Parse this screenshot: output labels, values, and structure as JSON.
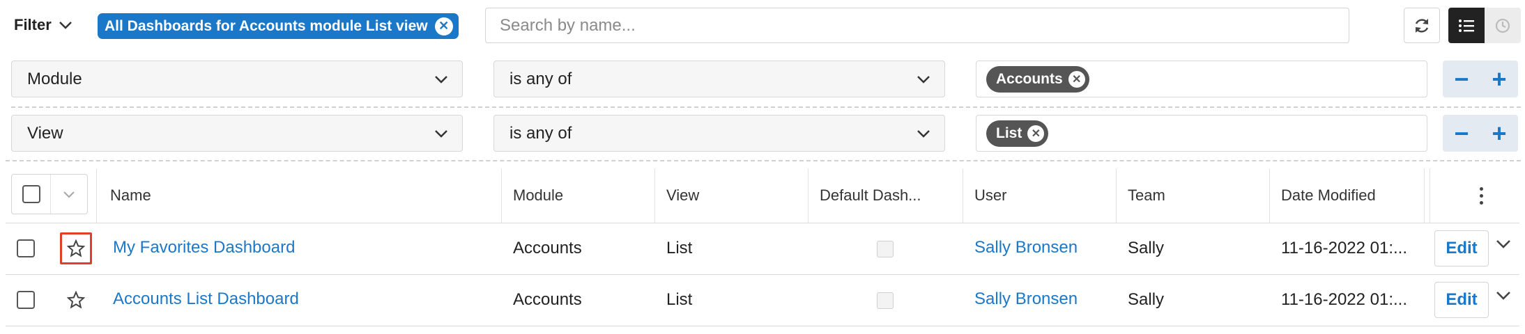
{
  "toolbar": {
    "filter_label": "Filter",
    "active_filter": "All Dashboards for Accounts module List view",
    "search_placeholder": "Search by name..."
  },
  "filter_rows": [
    {
      "field": "Module",
      "operator": "is any of",
      "tags": [
        "Accounts"
      ]
    },
    {
      "field": "View",
      "operator": "is any of",
      "tags": [
        "List"
      ]
    }
  ],
  "table": {
    "columns": [
      "Name",
      "Module",
      "View",
      "Default Dash...",
      "User",
      "Team",
      "Date Modified"
    ],
    "rows": [
      {
        "name": "My Favorites Dashboard",
        "module": "Accounts",
        "view": "List",
        "user": "Sally Bronsen",
        "team": "Sally",
        "date_modified": "11-16-2022 01:...",
        "action": "Edit",
        "favorite_highlighted": true
      },
      {
        "name": "Accounts List Dashboard",
        "module": "Accounts",
        "view": "List",
        "user": "Sally Bronsen",
        "team": "Sally",
        "date_modified": "11-16-2022 01:...",
        "action": "Edit",
        "favorite_highlighted": false
      }
    ]
  },
  "colors": {
    "accent": "#1b78c9",
    "highlight": "#e0402b",
    "tag_bg": "#555555"
  }
}
